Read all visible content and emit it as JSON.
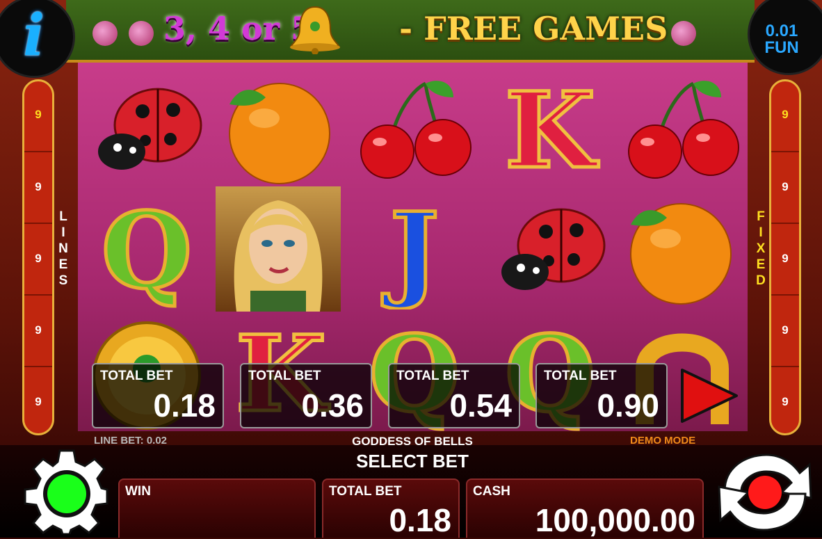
{
  "banner": {
    "prefix": "3, 4 or 5",
    "suffix": "- FREE GAMES",
    "bell_icon": "bell-icon"
  },
  "info_button": {
    "glyph": "i",
    "icon": "info-icon"
  },
  "denomination": {
    "value": "0.01",
    "currency": "FUN"
  },
  "reels": {
    "rows": [
      [
        "ladybug",
        "orange",
        "cherries",
        "K",
        "cherries"
      ],
      [
        "Q",
        "goddess",
        "J",
        "ladybug",
        "orange"
      ],
      [
        "coin",
        "K",
        "Q",
        "Q",
        "horseshoe"
      ]
    ]
  },
  "lines": {
    "left_label": [
      "L",
      "I",
      "N",
      "E",
      "S"
    ],
    "right_label": [
      "F",
      "I",
      "X",
      "E",
      "D"
    ],
    "left_numbers": [
      "9",
      "9",
      "9",
      "9",
      "9"
    ],
    "right_numbers": [
      "9",
      "9",
      "9",
      "9",
      "9"
    ]
  },
  "bet_options": [
    {
      "label": "TOTAL BET",
      "value": "0.18"
    },
    {
      "label": "TOTAL BET",
      "value": "0.36"
    },
    {
      "label": "TOTAL BET",
      "value": "0.54"
    },
    {
      "label": "TOTAL BET",
      "value": "0.90"
    }
  ],
  "status": {
    "line_bet": "LINE BET: 0.02",
    "game_title": "GODDESS OF BELLS",
    "prompt": "SELECT BET",
    "mode": "DEMO MODE"
  },
  "bottom": {
    "win_label": "WIN",
    "win_value": "",
    "total_bet_label": "TOTAL BET",
    "total_bet_value": "0.18",
    "cash_label": "CASH",
    "cash_value": "100,000.00"
  },
  "colors": {
    "accent_blue": "#1ab0ff",
    "gold": "#ffd34a",
    "reel_bg": "#b8307a",
    "strip_red": "#c0260e",
    "demo_orange": "#f08a1a",
    "spin_red": "#ff1a1a",
    "settings_green": "#1aff1a"
  }
}
